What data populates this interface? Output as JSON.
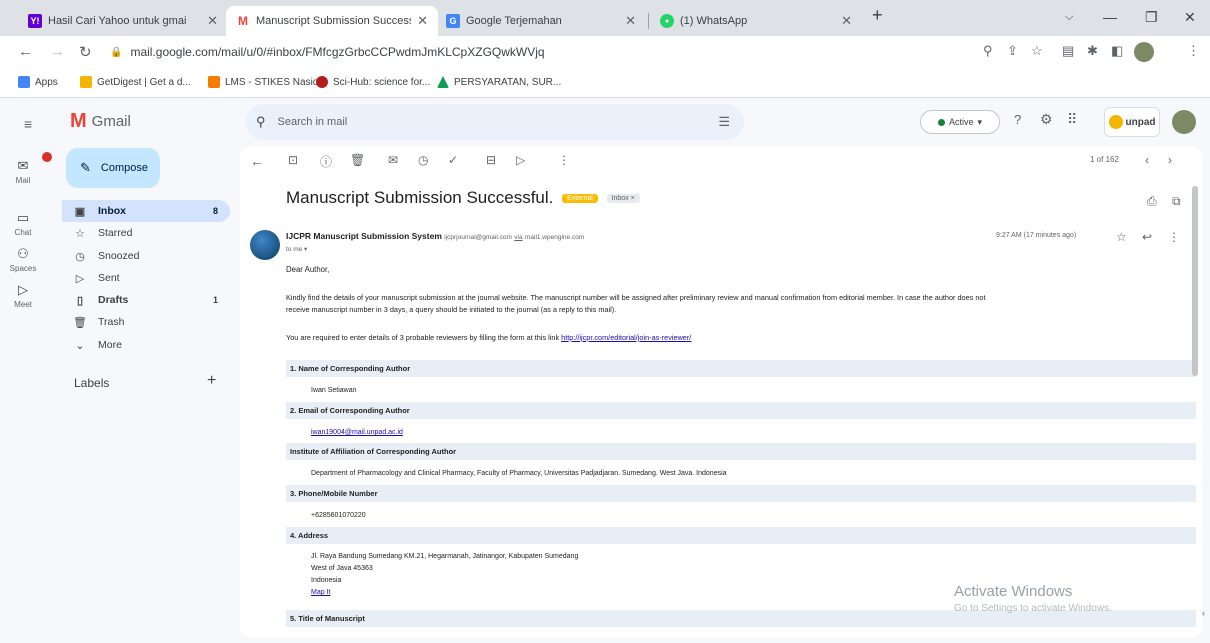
{
  "tabs": [
    {
      "title": "Hasil Cari Yahoo untuk gmai",
      "favicon_color": "#6001d2",
      "favicon_glyph": "Y!"
    },
    {
      "title": "Manuscript Submission Successf",
      "favicon_color": "#ea4335",
      "favicon_glyph": "M",
      "active": true
    },
    {
      "title": "Google Terjemahan",
      "favicon_color": "#4285f4",
      "favicon_glyph": "G"
    },
    {
      "title": "(1) WhatsApp",
      "favicon_color": "#25d366",
      "favicon_glyph": "●"
    }
  ],
  "url": "mail.google.com/mail/u/0/#inbox/FMfcgzGrbcCCPwdmJmKLCpXZGQwkWVjq",
  "bookmarks": [
    {
      "label": "Apps",
      "color": "#4285f4"
    },
    {
      "label": "GetDigest | Get a d...",
      "color": "#f4b400"
    },
    {
      "label": "LMS - STIKES Nasio...",
      "color": "#f57c00"
    },
    {
      "label": "Sci-Hub: science for...",
      "color": "#b71c1c"
    },
    {
      "label": "PERSYARATAN, SUR...",
      "color": "#0f9d58"
    }
  ],
  "gmail": {
    "brand": "Gmail",
    "search_placeholder": "Search in mail",
    "status": "Active",
    "org_badge": "unpad",
    "compose_label": "Compose",
    "rail": [
      {
        "label": "Mail",
        "icon": "mail-icon"
      },
      {
        "label": "Chat",
        "icon": "chat-icon"
      },
      {
        "label": "Spaces",
        "icon": "spaces-icon"
      },
      {
        "label": "Meet",
        "icon": "meet-icon"
      }
    ],
    "nav": [
      {
        "label": "Inbox",
        "count": "8",
        "icon": "inbox-icon",
        "active": true
      },
      {
        "label": "Starred",
        "count": "",
        "icon": "star-icon"
      },
      {
        "label": "Snoozed",
        "count": "",
        "icon": "clock-icon"
      },
      {
        "label": "Sent",
        "count": "",
        "icon": "send-icon"
      },
      {
        "label": "Drafts",
        "count": "1",
        "icon": "draft-icon"
      },
      {
        "label": "Trash",
        "count": "",
        "icon": "trash-icon"
      },
      {
        "label": "More",
        "count": "",
        "icon": "chevron-down-icon"
      }
    ],
    "labels_heading": "Labels",
    "pager": "1 of 162"
  },
  "email": {
    "subject": "Manuscript Submission Successful.",
    "tag_external": "External",
    "tag_inbox": "Inbox ×",
    "sender_name": "IJCPR Manuscript Submission System",
    "sender_email": "ijcprjournal@gmail.com",
    "via": "via",
    "via_domain": "mail1.wpengine.com",
    "to": "to me ▾",
    "time": "9:27 AM (17 minutes ago)",
    "greeting": "Dear Author,",
    "para1": "Kindly find the details of your manuscript submission at the journal website. The manuscript number will be assigned after preliminary review and manual confirmation from editorial member. In case the author does not",
    "para1b": "receive manuscript number in 3 days, a query should be initiated to the journal (as a reply to this mail).",
    "para2": "You are required to enter details of 3 probable reviewers by filling the form at this link",
    "para2_link": "http://ijcpr.com/editorial/join-as-reviewer/",
    "fields": [
      {
        "label": "1. Name of Corresponding Author",
        "value": "Iwan Setiawan"
      },
      {
        "label": "2. Email of Corresponding Author",
        "value": "iwan19004@mail.unpad.ac.id",
        "is_link": true
      },
      {
        "label": "Institute of Affiliation of Corresponding Author",
        "value": "Department of Pharmacology and Clinical Pharmacy, Faculty of Pharmacy, Universitas Padjadjaran. Sumedang. West Java. Indonesia"
      },
      {
        "label": "3. Phone/Mobile Number",
        "value": "+6285601070220"
      },
      {
        "label": "4. Address",
        "lines": [
          "Jl. Raya Bandung Sumedang KM.21, Hegarmanah, Jatinangor, Kabupaten Sumedang",
          "West of Java 45363",
          "Indonesia"
        ],
        "map_link": "Map It"
      },
      {
        "label": "5. Title of Manuscript",
        "value": ""
      }
    ]
  },
  "watermark": {
    "line1": "Activate Windows",
    "line2": "Go to Settings to activate Windows."
  }
}
